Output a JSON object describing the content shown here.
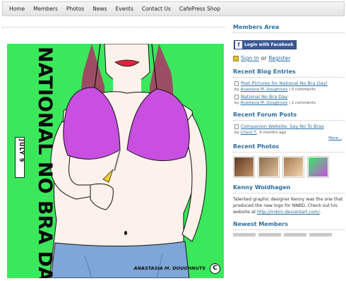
{
  "nav": [
    "Home",
    "Members",
    "Photos",
    "News",
    "Events",
    "Contact Us",
    "CafePress Shop"
  ],
  "hero": {
    "title": "NATIONAL NO BRA DAY",
    "date": "JULY 9",
    "signature": "ANASTASIA M. DOUGHNUTS",
    "copyright": "C"
  },
  "members_area": {
    "title": "Members Area",
    "facebook_button": "Login with Facebook",
    "sign_in": "Sign In",
    "or": "or",
    "register": "Register"
  },
  "blog": {
    "title": "Recent Blog Entries",
    "entries": [
      {
        "title": "Post Pictures for National No Bra Day!",
        "by": "by",
        "author": "Anastasia M. Doughnuts",
        "comments": "0 comments"
      },
      {
        "title": "National No Bra Day",
        "by": "by",
        "author": "Anastasia M. Doughnuts",
        "comments": "2 comments"
      }
    ]
  },
  "forum": {
    "title": "Recent Forum Posts",
    "post_title": "Companion Website: Say No To Bras",
    "by": "by",
    "author": "Chuck T.",
    "when": "9 months ago",
    "more": "More..."
  },
  "photos": {
    "title": "Recent Photos"
  },
  "kenny": {
    "title": "Kenny Woldhagen",
    "text": "Talented graphic designer Kenny was the one that produced the new logo for NNBD. Check out his website",
    "at": "at",
    "link": "http://inikini.deviantart.com/",
    "end": "."
  },
  "newest": {
    "title": "Newest Members"
  },
  "colors": {
    "accent": "#2c6e9e",
    "hero_bg": "#3be85c",
    "bra": "#c84fe0",
    "facebook": "#3b5998"
  },
  "icons": [
    "facebook-icon",
    "lock-icon",
    "document-icon",
    "copyright-icon"
  ]
}
